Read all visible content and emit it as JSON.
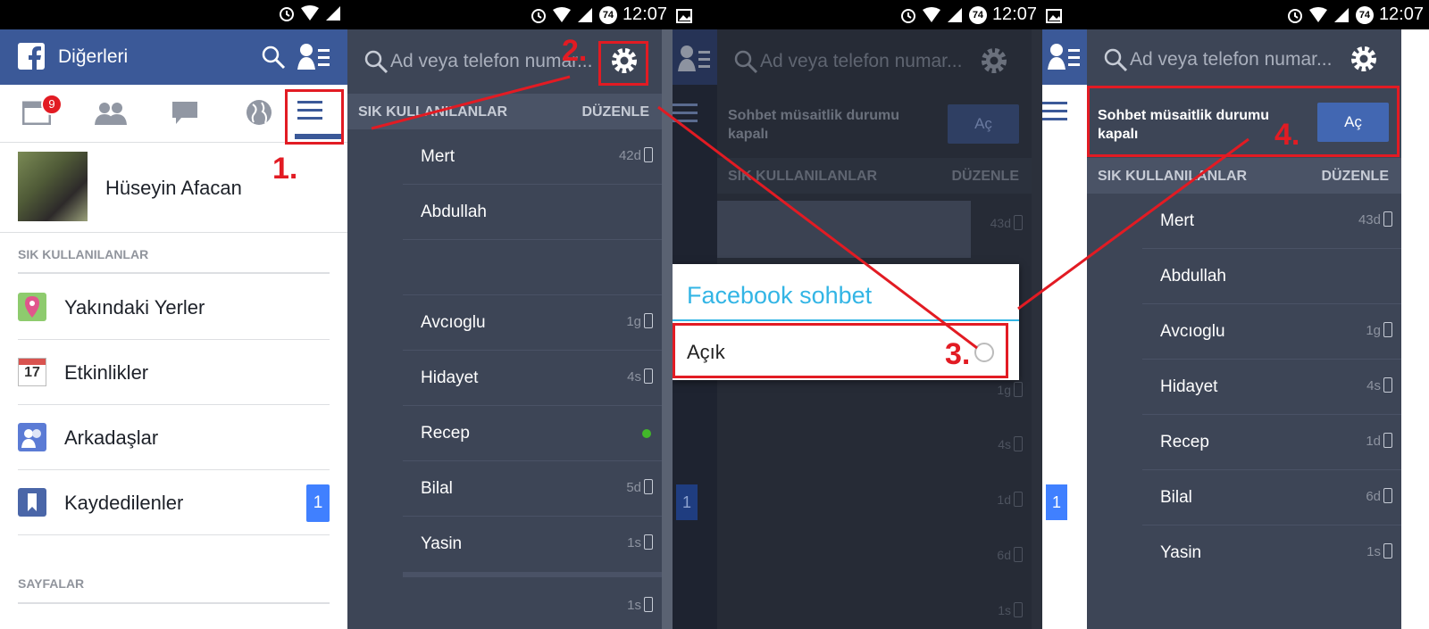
{
  "status": {
    "time": "12:07",
    "battery": "74"
  },
  "panel1": {
    "header_title": "Diğerleri",
    "notif_badge": "9",
    "profile_name": "Hüseyin Afacan",
    "favorites_head": "SIK KULLANILANLAR",
    "items": [
      {
        "label": "Yakındaki Yerler",
        "icon": "map-pin-icon"
      },
      {
        "label": "Etkinlikler",
        "icon": "calendar-icon",
        "icon_text": "17"
      },
      {
        "label": "Arkadaşlar",
        "icon": "friends-icon"
      },
      {
        "label": "Kaydedilenler",
        "icon": "bookmark-icon",
        "count": "1"
      }
    ],
    "pages_head": "SAYFALAR",
    "step": "1."
  },
  "panel2": {
    "search_placeholder": "Ad veya telefon numar...",
    "head_left": "SIK KULLANILANLAR",
    "head_right": "DÜZENLE",
    "friends": [
      {
        "name": "Mert",
        "meta": "42d"
      },
      {
        "name": "Abdullah",
        "meta": ""
      },
      {
        "name": "",
        "meta": ""
      },
      {
        "name": "Avcıoglu",
        "meta": "1g"
      },
      {
        "name": "Hidayet",
        "meta": "4s"
      },
      {
        "name": "Recep",
        "meta": ""
      },
      {
        "name": "Bilal",
        "meta": "5d"
      },
      {
        "name": "Yasin",
        "meta": "1s"
      }
    ],
    "last_meta": "1s",
    "step": "2."
  },
  "panel3": {
    "search_placeholder": "Ad veya telefon numar...",
    "chat_status": "Sohbet müsaitlik durumu kapalı",
    "on_button": "Aç",
    "head_left": "SIK KULLANILANLAR",
    "head_right": "DÜZENLE",
    "dialog_title": "Facebook sohbet",
    "dialog_option": "Açık",
    "metas": [
      "43d",
      "1g",
      "4s",
      "1d",
      "6d",
      "1s"
    ],
    "badge": "1",
    "step": "3."
  },
  "panel4": {
    "search_placeholder": "Ad veya telefon numar...",
    "chat_status": "Sohbet müsaitlik durumu kapalı",
    "on_button": "Aç",
    "head_left": "SIK KULLANILANLAR",
    "head_right": "DÜZENLE",
    "friends": [
      {
        "name": "Mert",
        "meta": "43d"
      },
      {
        "name": "Abdullah",
        "meta": ""
      },
      {
        "name": "Avcıoglu",
        "meta": "1g"
      },
      {
        "name": "Hidayet",
        "meta": "4s"
      },
      {
        "name": "Recep",
        "meta": "1d"
      },
      {
        "name": "Bilal",
        "meta": "6d"
      },
      {
        "name": "Yasin",
        "meta": "1s"
      }
    ],
    "badge": "1",
    "step": "4."
  },
  "colors": {
    "fb_blue": "#3b5998",
    "drawer": "#3d4556",
    "accent_red": "#e21b23",
    "online": "#42b72a",
    "dialog_title": "#33b5e5"
  }
}
